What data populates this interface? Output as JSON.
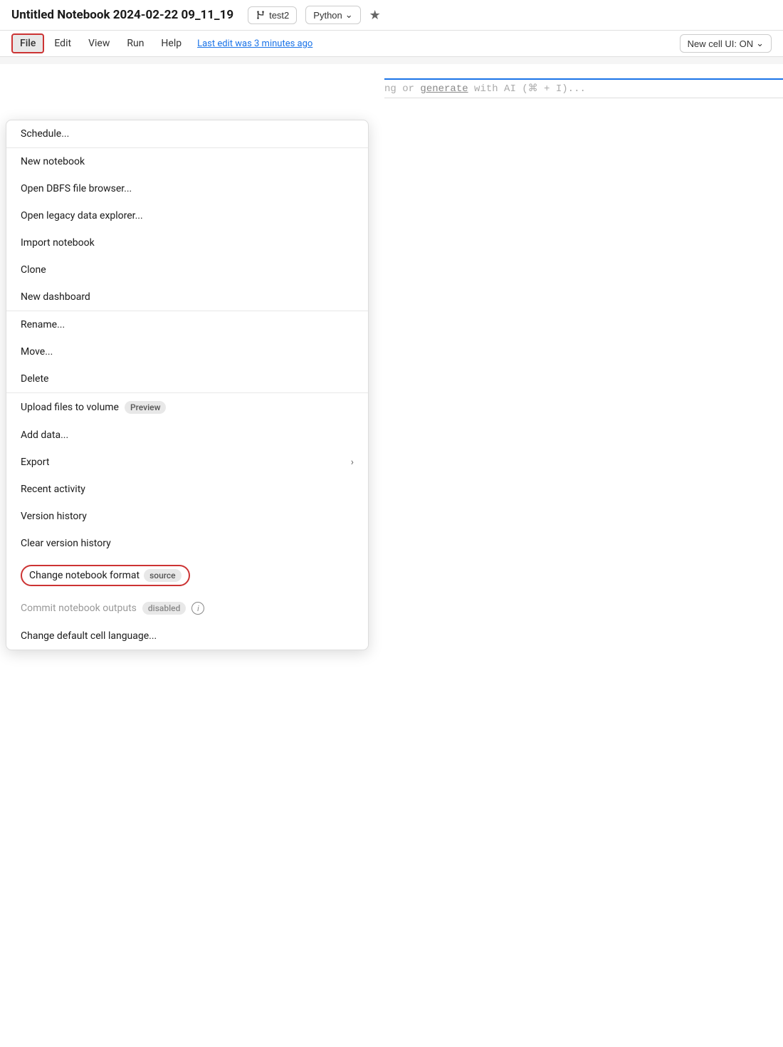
{
  "header": {
    "title": "Untitled Notebook 2024-02-22 09_11_19",
    "branch": "test2",
    "language": "Python",
    "last_edit": "Last edit was 3 minutes ago",
    "new_cell_ui": "New cell UI: ON"
  },
  "menubar": {
    "items": [
      {
        "label": "File",
        "active": true
      },
      {
        "label": "Edit",
        "active": false
      },
      {
        "label": "View",
        "active": false
      },
      {
        "label": "Run",
        "active": false
      },
      {
        "label": "Help",
        "active": false
      }
    ]
  },
  "dropdown": {
    "sections": [
      {
        "items": [
          {
            "label": "Schedule...",
            "badge": null,
            "chevron": false,
            "disabled": false,
            "highlighted": false,
            "info": false
          }
        ]
      },
      {
        "items": [
          {
            "label": "New notebook",
            "badge": null,
            "chevron": false,
            "disabled": false,
            "highlighted": false,
            "info": false
          },
          {
            "label": "Open DBFS file browser...",
            "badge": null,
            "chevron": false,
            "disabled": false,
            "highlighted": false,
            "info": false
          },
          {
            "label": "Open legacy data explorer...",
            "badge": null,
            "chevron": false,
            "disabled": false,
            "highlighted": false,
            "info": false
          },
          {
            "label": "Import notebook",
            "badge": null,
            "chevron": false,
            "disabled": false,
            "highlighted": false,
            "info": false
          },
          {
            "label": "Clone",
            "badge": null,
            "chevron": false,
            "disabled": false,
            "highlighted": false,
            "info": false
          },
          {
            "label": "New dashboard",
            "badge": null,
            "chevron": false,
            "disabled": false,
            "highlighted": false,
            "info": false
          }
        ]
      },
      {
        "items": [
          {
            "label": "Rename...",
            "badge": null,
            "chevron": false,
            "disabled": false,
            "highlighted": false,
            "info": false
          },
          {
            "label": "Move...",
            "badge": null,
            "chevron": false,
            "disabled": false,
            "highlighted": false,
            "info": false
          },
          {
            "label": "Delete",
            "badge": null,
            "chevron": false,
            "disabled": false,
            "highlighted": false,
            "info": false
          }
        ]
      },
      {
        "items": [
          {
            "label": "Upload files to volume",
            "badge": "Preview",
            "chevron": false,
            "disabled": false,
            "highlighted": false,
            "info": false
          },
          {
            "label": "Add data...",
            "badge": null,
            "chevron": false,
            "disabled": false,
            "highlighted": false,
            "info": false
          },
          {
            "label": "Export",
            "badge": null,
            "chevron": true,
            "disabled": false,
            "highlighted": false,
            "info": false
          },
          {
            "label": "Recent activity",
            "badge": null,
            "chevron": false,
            "disabled": false,
            "highlighted": false,
            "info": false
          },
          {
            "label": "Version history",
            "badge": null,
            "chevron": false,
            "disabled": false,
            "highlighted": false,
            "info": false
          },
          {
            "label": "Clear version history",
            "badge": null,
            "chevron": false,
            "disabled": false,
            "highlighted": false,
            "info": false
          },
          {
            "label": "Change notebook format",
            "badge": "source",
            "chevron": false,
            "disabled": false,
            "highlighted": true,
            "info": false
          },
          {
            "label": "Commit notebook outputs",
            "badge": "disabled",
            "chevron": false,
            "disabled": true,
            "highlighted": false,
            "info": true
          },
          {
            "label": "Change default cell language...",
            "badge": null,
            "chevron": false,
            "disabled": false,
            "highlighted": false,
            "info": false
          }
        ]
      }
    ]
  },
  "cell": {
    "hint": "ng or generate with AI (⌘ + I)..."
  }
}
